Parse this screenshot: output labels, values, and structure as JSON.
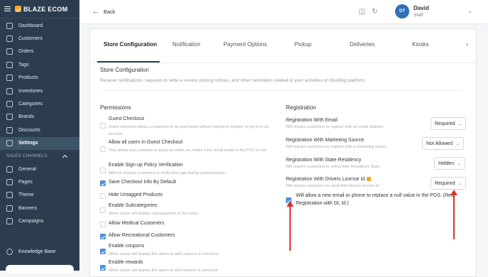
{
  "brand": {
    "name": "BLAZE ECOM"
  },
  "sidebar": {
    "items": [
      {
        "label": "Dashboard"
      },
      {
        "label": "Customers"
      },
      {
        "label": "Orders"
      },
      {
        "label": "Tags"
      },
      {
        "label": "Products"
      },
      {
        "label": "Inventories"
      },
      {
        "label": "Categories"
      },
      {
        "label": "Brands"
      },
      {
        "label": "Discounts"
      },
      {
        "label": "Settings"
      }
    ],
    "sales_title": "SALES CHANNELS",
    "sales_items": [
      {
        "label": "General"
      },
      {
        "label": "Pages"
      },
      {
        "label": "Theme"
      },
      {
        "label": "Banners"
      },
      {
        "label": "Campaigns"
      }
    ],
    "knowledge_base": "Knowledge Base"
  },
  "topbar": {
    "back_label": "Back",
    "user_initials": "DT",
    "user_name": "David",
    "user_role": "Staff"
  },
  "tabs": [
    "Store Configuration",
    "Notification",
    "Payment Options",
    "Pickup",
    "Deliveries",
    "Kiosks"
  ],
  "store_config": {
    "title": "Store Configuration",
    "description": "Receive notifications, requests to write a review, pricing notices, and other reminders related to your activities on Building platform."
  },
  "permissions": {
    "title": "Permissions",
    "items": [
      {
        "label": "Guest Checkout",
        "desc": "Guest checkout allows a customer to do purchases without having to register or log in to an account.",
        "checked": false
      },
      {
        "label": "Allow all users in Guest Checkout",
        "desc": "This allows any customer to place an order, no matter if the email exists in the POS or not.",
        "checked": false
      },
      {
        "label": "Enable Sign-up Policy Verification",
        "desc": "Will not request customers to verify their age during authentication.",
        "checked": false
      },
      {
        "label": "Save Checkout Info By Default",
        "desc": "",
        "checked": true
      },
      {
        "label": "Hide Untagged Products",
        "desc": "",
        "checked": false
      },
      {
        "label": "Enable Subcategories",
        "desc": "When active will display subcategories in the menu.",
        "checked": false
      },
      {
        "label": "Allow Medical Customers",
        "desc": "",
        "checked": false
      },
      {
        "label": "Allow Recreational Customers",
        "desc": "",
        "checked": true
      },
      {
        "label": "Enable coupons",
        "desc": "When active will display the option to add coupons in checkout.",
        "checked": true
      },
      {
        "label": "Enable rewards",
        "desc": "When active will display the option to add rewards in checkout.",
        "checked": true
      }
    ]
  },
  "registration": {
    "title": "Registration",
    "items": [
      {
        "label": "Registration With Email",
        "desc": "Will require customers to register with an email address",
        "value": "Required"
      },
      {
        "label": "Registration With Marketing Source",
        "desc": "Will require customers to register with a marketing source",
        "value": "Not Allowed"
      },
      {
        "label": "Registration With State Residency",
        "desc": "Will require customers to select their Residency State",
        "value": "Hidden"
      },
      {
        "label": "Registration With Drivers License Id",
        "desc": "Will require customers to input their drivers license id",
        "value": "Required"
      }
    ],
    "null_value_note": "Will allow a new email or phone to replace a null value in the POS. (Req. Registration with DL Id.)",
    "null_value_checked": true
  },
  "colors": {
    "sidebar": "#2b3d4f",
    "accent": "#4a90d9",
    "annotation": "#d9312b"
  }
}
